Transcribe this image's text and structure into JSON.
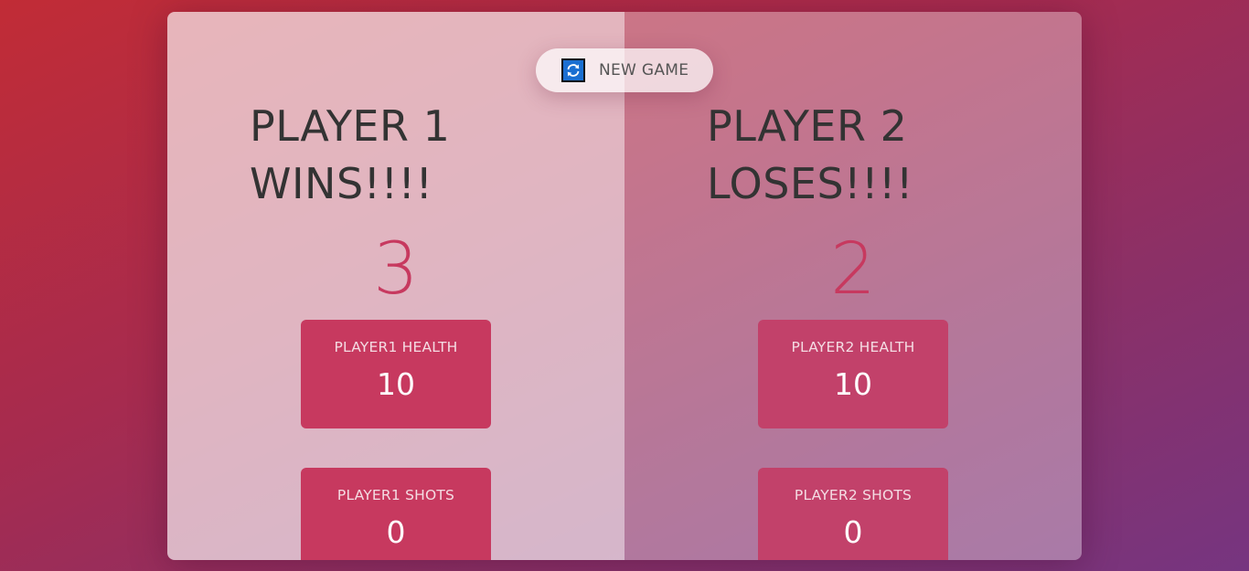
{
  "new_game": {
    "label": "NEW GAME",
    "icon": "refresh-icon",
    "icon_color": "#1a6fd1"
  },
  "players": [
    {
      "name_line1": "PLAYER 1",
      "name_line2": "WINS!!!!",
      "score": "3",
      "health_label": "PLAYER1 HEALTH",
      "health_value": "10",
      "shots_label": "PLAYER1 SHOTS",
      "shots_value": "0"
    },
    {
      "name_line1": "PLAYER 2",
      "name_line2": "LOSES!!!!",
      "score": "2",
      "health_label": "PLAYER2 HEALTH",
      "health_value": "10",
      "shots_label": "PLAYER2 SHOTS",
      "shots_value": "0"
    }
  ],
  "colors": {
    "accent": "#c7395f",
    "text": "#333333",
    "background_start": "#c12c36",
    "background_end": "#763580"
  }
}
